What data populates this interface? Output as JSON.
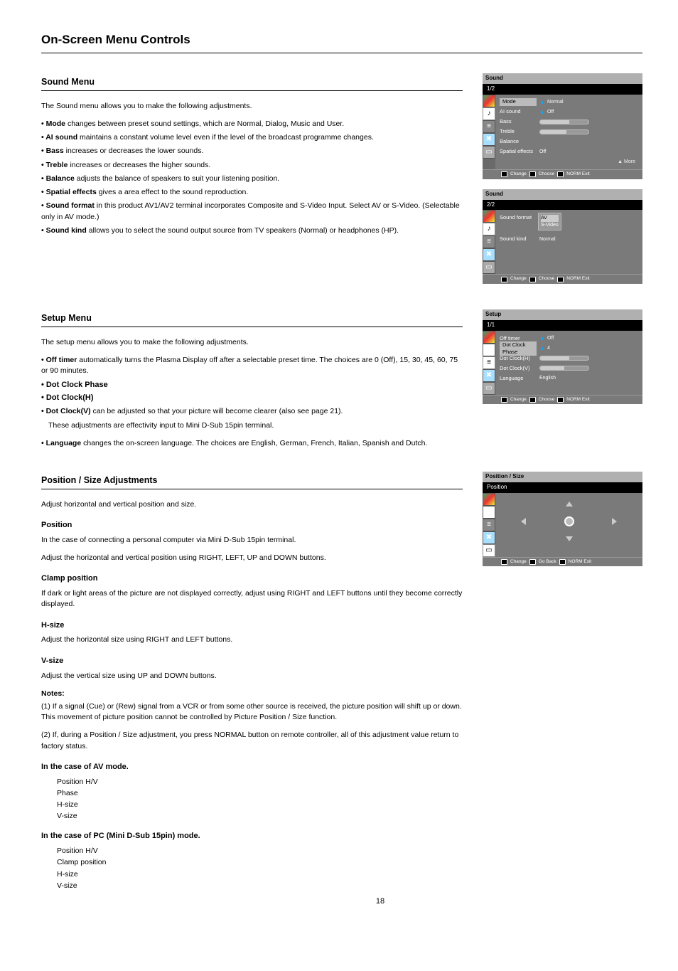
{
  "page_title": "On-Screen Menu Controls",
  "page_number": "18",
  "sections": {
    "sound": {
      "heading": "Sound Menu",
      "intro": "The Sound menu allows you to make the following adjustments.",
      "items": {
        "mode_label": "• Mode",
        "mode_text": "changes between preset sound settings, which are Normal, Dialog, Music and User.",
        "ai_label": "• AI sound",
        "ai_text": "maintains a constant volume level even if the level of the broadcast programme changes.",
        "bass_label": "• Bass",
        "bass_text": "increases or decreases the lower sounds.",
        "treble_label": "• Treble",
        "treble_text": "increases or decreases the higher sounds.",
        "balance_label": "• Balance",
        "balance_text": "adjusts the balance of speakers to suit your listening position.",
        "spatial_label": "• Spatial effects",
        "spatial_text": "gives a area effect to the sound reproduction.",
        "s_format_label": "• Sound format",
        "s_format_text": "in this product AV1/AV2 terminal incorporates Composite and S-Video Input. Select AV or S-Video. (Selectable only in AV mode.)",
        "s_kind_label": "• Sound kind",
        "s_kind_text": "allows you to select the sound output source from TV speakers (Normal) or headphones (HP)."
      },
      "osd_title_panel": "Sound",
      "osd": {
        "mode": "Mode",
        "mode_v": "Normal",
        "ai": "AI sound",
        "ai_v": "Off",
        "bass": "Bass",
        "treble": "Treble",
        "balance": "Balance",
        "spatial": "Spatial effects",
        "spatial_v": "Off"
      },
      "osd2": {
        "sformat": "Sound format",
        "opt_av": "AV",
        "opt_sv": "S-Video",
        "skind": "Sound kind",
        "skind_v": "Normal"
      },
      "foot": {
        "change": "Change",
        "choose": "Choose",
        "exit": "Exit",
        "goback": "Go Back",
        "norm_exit": "NORM     Exit"
      },
      "note": "▲ More"
    },
    "setup": {
      "heading": "Setup Menu",
      "intro": "The setup menu allows you to make the following adjustments.",
      "items": {
        "off_timer_label": "• Off timer",
        "off_timer_text": "automatically turns the Plasma Display off after a selectable preset time. The choices are 0 (Off), 15, 30, 45, 60, 75 or 90 minutes.",
        "phase_label": "• Dot Clock Phase",
        "h_label": "• Dot Clock(H)",
        "v_label": "• Dot Clock(V)",
        "dot_text": "can be adjusted so that your picture will become clearer (also see page 21).",
        "dot_note": "These adjustments are effectivity input to Mini D-Sub 15pin terminal.",
        "lang_label": "• Language",
        "lang_text": "changes the on-screen language. The choices are English, German, French, Italian, Spanish and Dutch."
      },
      "osd_title_panel": "Setup",
      "osd": {
        "timer": "Off timer",
        "timer_v": "Off",
        "phase": "Dot Clock Phase",
        "phase_v": "4",
        "h": "Dot Clock(H)",
        "v": "Dot Clock(V)",
        "lang": "Language",
        "lang_v": "English"
      }
    },
    "position": {
      "heading": "Position / Size Adjustments",
      "osd_title_panel": "Position / Size",
      "pos_label": "Position",
      "lead": "Adjust horizontal and vertical position and size.",
      "sub_position": "Position",
      "pos_body1": "In the case of connecting a personal computer via Mini D-Sub 15pin terminal.",
      "pos_body2": "Adjust the horizontal and vertical position using RIGHT, LEFT, UP and DOWN buttons.",
      "sub_clamp": "Clamp position",
      "clamp_body": "If dark or light areas of the picture are not displayed correctly, adjust using RIGHT and LEFT buttons until they become correctly displayed.",
      "sub_hsize": "H-size",
      "hsize_body": "Adjust the horizontal size using RIGHT and LEFT buttons.",
      "sub_vsize": "V-size",
      "vsize_body": "Adjust the vertical size using UP and DOWN buttons.",
      "notes_heading": "Notes:",
      "notes": [
        "(1) If a signal (Cue) or (Rew) signal from a VCR or from some other source is received, the picture position will shift up or down. This movement of picture position cannot be controlled by Picture Position / Size function.",
        "(2) If, during a Position / Size adjustment, you press NORMAL button on remote controller, all of this adjustment value return to factory status."
      ],
      "sub_avmode": "In the case of AV mode.",
      "av_items": [
        "Position H/V",
        "Phase",
        "H-size",
        "V-size"
      ],
      "sub_pcmode": "In the case of PC (Mini D-Sub 15pin) mode.",
      "pc_items": [
        "Position H/V",
        "Clamp position",
        "H-size",
        "V-size"
      ]
    }
  }
}
